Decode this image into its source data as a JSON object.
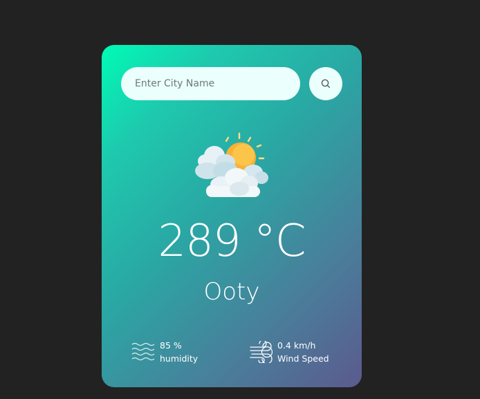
{
  "search": {
    "placeholder": "Enter City Name",
    "value": "",
    "button_icon": "search-icon"
  },
  "weather": {
    "icon": "partly-cloudy-icon",
    "temperature": "289 °C",
    "city": "Ooty"
  },
  "details": {
    "humidity": {
      "icon": "humidity-waves-icon",
      "value": "85 %",
      "label": "humidity"
    },
    "wind": {
      "icon": "wind-icon",
      "value": "0.4 km/h",
      "label": "Wind Speed"
    }
  },
  "colors": {
    "page_background": "#222222",
    "card_gradient_start": "#00fbb5",
    "card_gradient_end": "#5b5a8e",
    "input_background": "#ebfffc",
    "text": "#ffffff"
  }
}
